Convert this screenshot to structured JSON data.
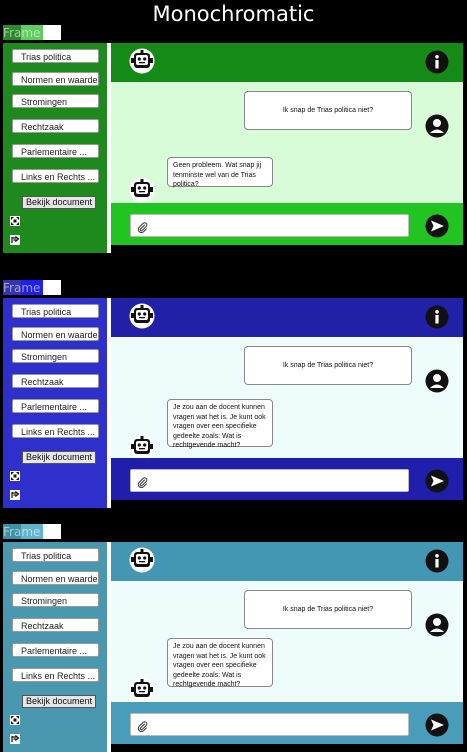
{
  "page_title": "Monochromatic",
  "frames": [
    {
      "tag_label": "Frame 5",
      "sidebar_bg": "#1e8a1e",
      "swatch1": "#2c8a2c",
      "swatch2": "#5fce5f",
      "header_bg": "#168a16",
      "body_bg": "#d8fbd8",
      "footer_bg": "#22c422",
      "sidebar_items": [
        "Trias politica",
        "Normen en waarde",
        "Stromingen",
        "Rechtzaak",
        "Parlementaire ...",
        "Links en Rechts ..."
      ],
      "document_button": "Bekijk document",
      "user_message": "Ik snap de Trias politica niet?",
      "bot_message": "Geen probleem. Wat snap jij tenminste wel van de Trias politica?"
    },
    {
      "tag_label": "Frame 8",
      "sidebar_bg": "#2f2fcc",
      "swatch1": "#3535b0",
      "swatch2": "#2020ee",
      "header_bg": "#2121a8",
      "body_bg": "#eefcfc",
      "footer_bg": "#1f1fab",
      "sidebar_items": [
        "Trias politica",
        "Normen en waarde",
        "Stromingen",
        "Rechtzaak",
        "Parlementaire ...",
        "Links en Rechts ..."
      ],
      "document_button": "Bekijk document",
      "user_message": "Ik snap de Trias politica niet?",
      "bot_message": "Je zou aan de docent kunnen vragen wat het is. Je kunt ook vragen over een specifieke gedeelte zoals: Wat is rechtgevende macht?"
    },
    {
      "tag_label": "Frame 9",
      "sidebar_bg": "#4a97b0",
      "swatch1": "#3c90a8",
      "swatch2": "#61b4cc",
      "header_bg": "#4497b3",
      "body_bg": "#eefcfc",
      "footer_bg": "#4a9dba",
      "sidebar_items": [
        "Trias politica",
        "Normen en waarde",
        "Stromingen",
        "Rechtzaak",
        "Parlementaire ...",
        "Links en Rechts ..."
      ],
      "document_button": "Bekijk document",
      "user_message": "Ik snap de Trias politica niet?",
      "bot_message": "Je zou aan de docent kunnen vragen wat het is. Je kunt ook vragen over een specifieke gedeelte zoals: Wat is rechtgevende macht?"
    }
  ]
}
